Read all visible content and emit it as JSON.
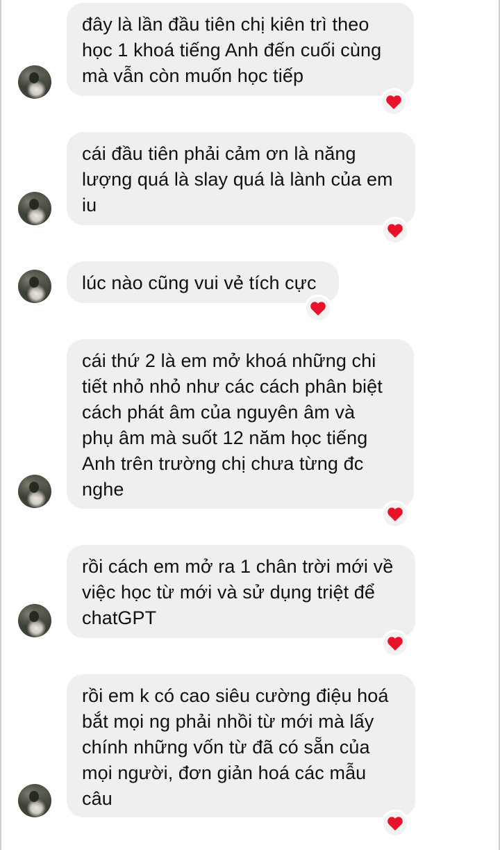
{
  "conversation": {
    "messages": [
      {
        "text": "đây là lần đầu tiên chị kiên trì theo\nhọc 1 khoá tiếng Anh đến cuối cùng\nmà vẫn còn muốn học tiếp",
        "reaction": "heart-icon"
      },
      {
        "text": "cái đầu tiên phải cảm ơn là năng\nlượng quá là slay quá là lành của em\niu",
        "reaction": "heart-icon"
      },
      {
        "text": "lúc nào cũng vui vẻ tích cực",
        "reaction": "heart-icon"
      },
      {
        "text": "cái thứ 2 là em mở khoá những chi\ntiết nhỏ nhỏ như các cách phân biệt\ncách phát âm của nguyên âm và\nphụ âm mà suốt 12 năm học tiếng\nAnh trên trường chị chưa từng đc\nnghe",
        "reaction": "heart-icon"
      },
      {
        "text": "rồi cách em mở ra 1 chân trời mới về\nviệc học từ mới và sử dụng triệt để\nchatGPT",
        "reaction": "heart-icon"
      },
      {
        "text": "rồi em k có cao siêu cường điệu hoá\nbắt mọi ng phải nhồi từ mới mà lấy\nchính những vốn từ đã có sẵn của\nmọi người, đơn giản hoá các mẫu\ncâu",
        "reaction": "heart-icon"
      }
    ]
  },
  "colors": {
    "bubble": "#efefef",
    "text": "#111111",
    "heart": "#e8132b"
  }
}
